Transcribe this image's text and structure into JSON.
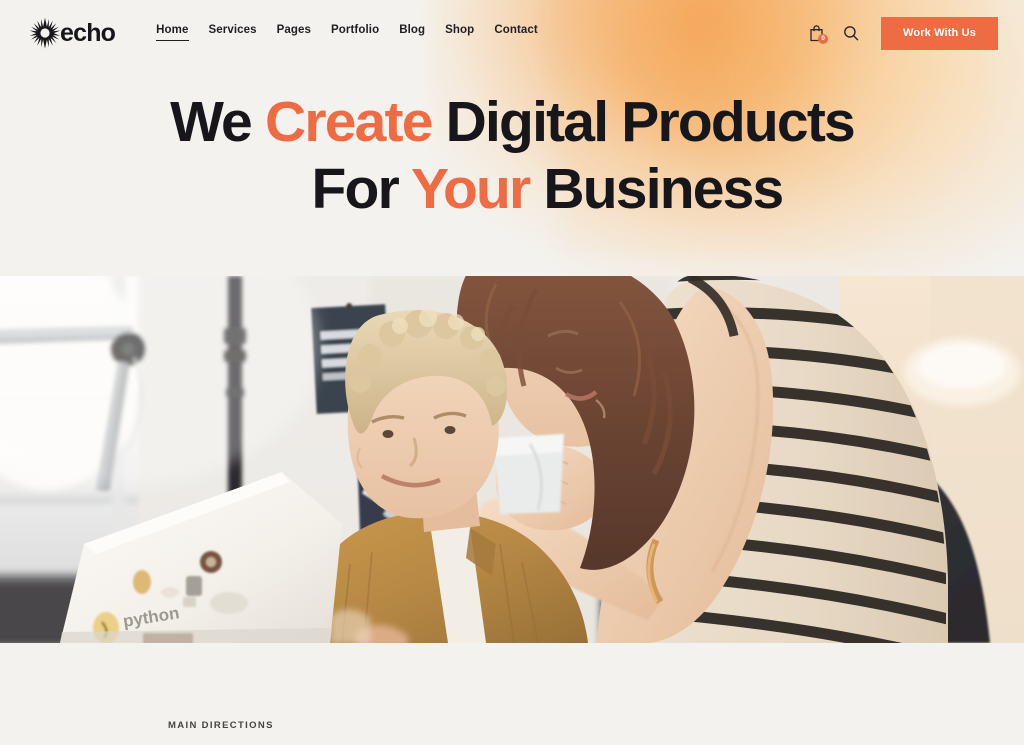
{
  "theme": {
    "background": "#F4F2EE",
    "accent": "#EE6B43",
    "text_dark": "#17161A",
    "glow_orange": "#F3943E"
  },
  "header": {
    "logo": {
      "mark": "starburst-icon",
      "word": "echo"
    },
    "nav": [
      {
        "label": "Home",
        "active": true
      },
      {
        "label": "Services",
        "active": false
      },
      {
        "label": "Pages",
        "active": false
      },
      {
        "label": "Portfolio",
        "active": false
      },
      {
        "label": "Blog",
        "active": false
      },
      {
        "label": "Shop",
        "active": false
      },
      {
        "label": "Contact",
        "active": false
      }
    ],
    "cart": {
      "icon": "shopping-bag-icon",
      "badge_count": "0"
    },
    "search": {
      "icon": "search-icon"
    },
    "cta": {
      "label": "Work With Us"
    }
  },
  "hero": {
    "line1": {
      "part1": "We ",
      "accent": "Create",
      "part2": " Digital Products"
    },
    "line2": {
      "part1": "For ",
      "accent": "Your",
      "part2": " Business"
    },
    "image": {
      "alt": "Two colleagues in a bright office looking at a sticker-covered white laptop; a woman in a black-and-white striped tank top holds a mug and leans over a smiling blond man in a tan corduroy shirt",
      "details": {
        "laptop_sticker_text": "python",
        "posters": "dark navy posters pinned to the wall",
        "lamp": "articulated desk lamp by the window"
      }
    }
  },
  "below": {
    "eyebrow": "MAIN DIRECTIONS"
  }
}
